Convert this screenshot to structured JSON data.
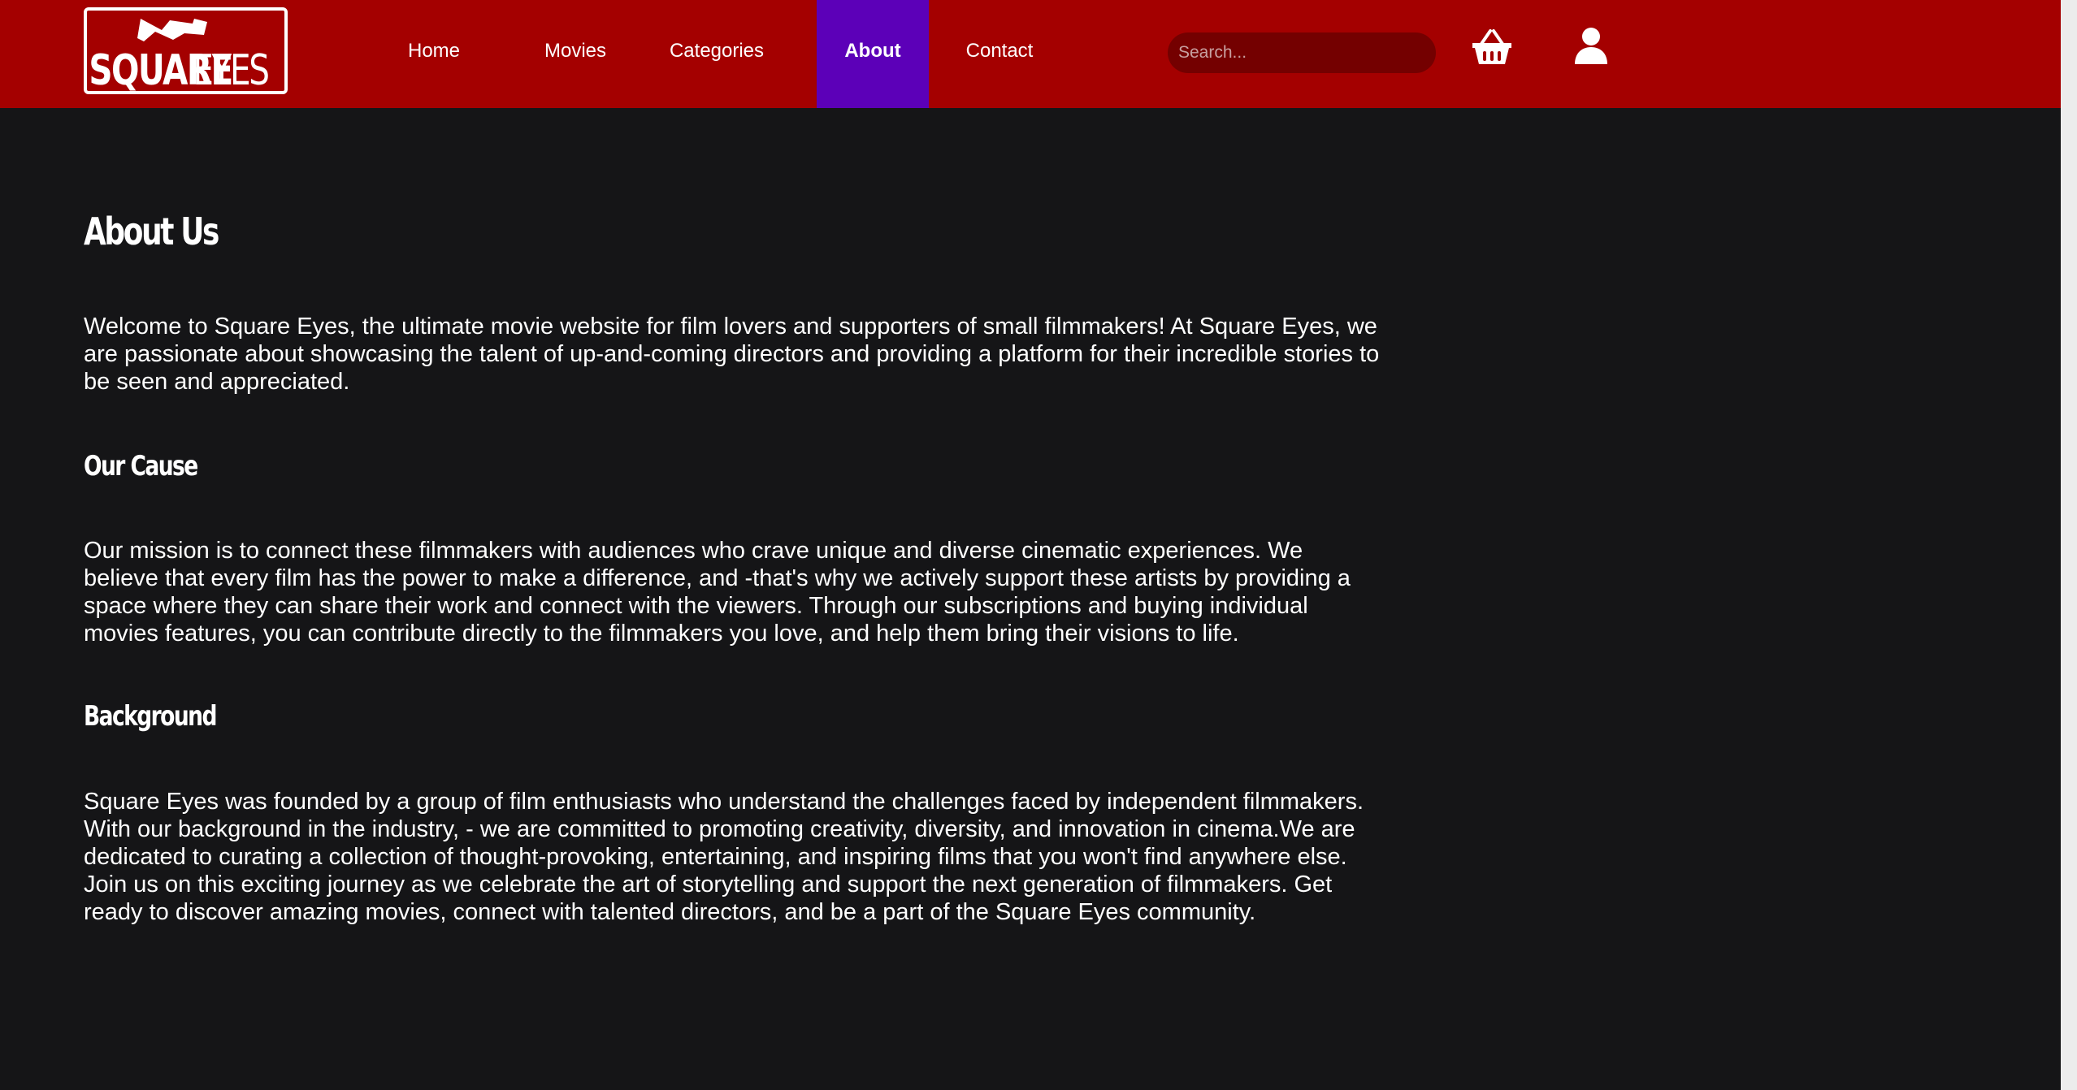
{
  "header": {
    "logo_text": "SQUARE EYES",
    "nav": [
      {
        "label": "Home"
      },
      {
        "label": "Movies"
      },
      {
        "label": "Categories"
      },
      {
        "label": "About",
        "active": true
      },
      {
        "label": "Contact"
      }
    ],
    "search_placeholder": "Search...",
    "cart_icon": "basket-icon",
    "user_icon": "user-icon"
  },
  "main": {
    "title": "About Us",
    "intro": "Welcome to Square Eyes, the ultimate movie website for film lovers and supporters of small filmmakers! At Square Eyes, we are passionate about showcasing the talent of up-and-coming directors and providing a platform for their incredible stories to be seen and appreciated.",
    "sections": [
      {
        "heading": "Our Cause",
        "body": "Our mission is to connect these filmmakers with audiences who crave unique and diverse cinematic experiences. We believe that every film has the power to make a difference, and -that's why we actively support these artists by providing a space where they can share their work and connect with the viewers. Through our subscriptions and buying individual movies features, you can contribute directly to the filmmakers you love, and help them bring their visions to life."
      },
      {
        "heading": "Background",
        "body": "Square Eyes was founded by a group of film enthusiasts who understand the challenges faced by independent filmmakers. With our background in the industry, - we are committed to promoting creativity, diversity, and innovation in cinema.We are dedicated to curating a collection of thought-provoking, entertaining, and inspiring films that you won't find anywhere else. Join us on this exciting journey as we celebrate the art of storytelling and support the next generation of filmmakers. Get ready to discover amazing movies, connect with talented directors, and be a part of the Square Eyes community."
      }
    ]
  },
  "colors": {
    "header_bg": "#a40000",
    "active_nav_bg": "#5c00b8",
    "page_bg": "#151517",
    "search_bg": "#740000"
  }
}
